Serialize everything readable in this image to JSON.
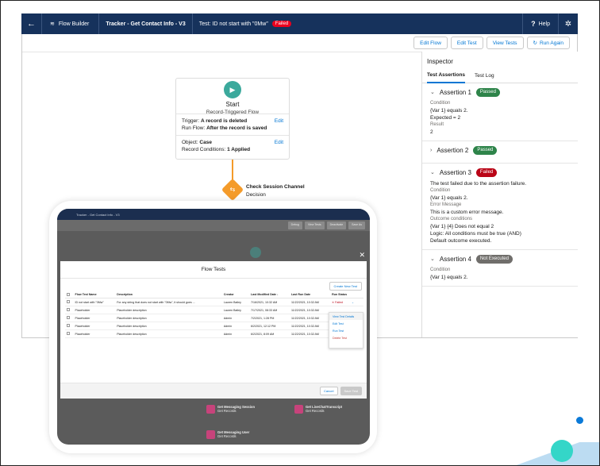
{
  "topbar": {
    "app_name": "Flow Builder",
    "flow_title": "Tracker - Get Contact Info - V3",
    "test_title": "Test: ID not start with \"0Mw\"",
    "test_status": "Failed",
    "help": "Help"
  },
  "toolbar": {
    "edit_flow": "Edit Flow",
    "edit_test": "Edit Test",
    "view_tests": "View Tests",
    "run_again": "Run Again"
  },
  "start": {
    "title": "Start",
    "subtitle": "Record-Triggered Flow",
    "trigger_label": "Trigger:",
    "trigger_value": "A record is deleted",
    "run_label": "Run Flow:",
    "run_value": "After the record is saved",
    "object_label": "Object:",
    "object_value": "Case",
    "conditions_label": "Record Conditions:",
    "conditions_value": "1 Applied",
    "edit": "Edit"
  },
  "decision": {
    "name": "Check Session Channel",
    "type": "Decision"
  },
  "inspector": {
    "title": "Inspector",
    "tabs": [
      "Test Assertions",
      "Test Log"
    ],
    "assertions": [
      {
        "name": "Assertion 1",
        "status": "Passed",
        "lines": [
          [
            "Condition",
            "lbl"
          ],
          [
            "{Var 1} equals 2.",
            ""
          ],
          [
            "Expected = 2",
            ""
          ],
          [
            "Result",
            "lbl"
          ],
          [
            "2",
            ""
          ]
        ]
      },
      {
        "name": "Assertion 2",
        "status": "Passed",
        "lines": []
      },
      {
        "name": "Assertion 3",
        "status": "Failed",
        "lines": [
          [
            "The test failed due to the assertion failure.",
            ""
          ],
          [
            "Condition",
            "lbl"
          ],
          [
            "{Var 1} equals 2.",
            ""
          ],
          [
            "Error Message",
            "lbl"
          ],
          [
            "This is a custom error message.",
            ""
          ],
          [
            "Outcome conditions",
            "lbl"
          ],
          [
            "{Var 1} {4} Does not equal 2",
            ""
          ],
          [
            "Logic: All conditions must be true (AND)",
            ""
          ],
          [
            "Default outcome executed.",
            ""
          ]
        ]
      },
      {
        "name": "Assertion 4",
        "status": "Not Executed",
        "lines": [
          [
            "Condition",
            "lbl"
          ],
          [
            "{Var 1} equals 2.",
            ""
          ]
        ]
      }
    ]
  },
  "overlay": {
    "header_title": "Tracker - Get Contact Info - V3",
    "bar_buttons": [
      "Debug",
      "View Tests",
      "Deactivate",
      "Save As"
    ],
    "modal_title": "Flow Tests",
    "create_button": "Create New Test",
    "columns": [
      "Flow Test Name",
      "Description",
      "Creator",
      "Last Modified Date ↓",
      "Last Run Date",
      "Run Status"
    ],
    "rows": [
      [
        "ID not start with \"0Mw\"",
        "For any string that does not start with \"0Mw\", it should goes ...",
        "Lauren Bailey",
        "7/16/2021, 10:32 AM",
        "11/22/2021, 10:32 AM",
        "Failed"
      ],
      [
        "Placeholder",
        "Placeholder description",
        "Lauren Bailey",
        "7/17/2021, 08:33 AM",
        "11/22/2021, 10:32 AM",
        ""
      ],
      [
        "Placeholder",
        "Placeholder description",
        "Admin",
        "7/2/2021, 1:28 PM",
        "11/22/2021, 10:32 AM",
        ""
      ],
      [
        "Placeholder",
        "Placeholder description",
        "Admin",
        "6/2/2021, 12:12 PM",
        "11/22/2021, 10:32 AM",
        ""
      ],
      [
        "Placeholder",
        "Placeholder description",
        "Admin",
        "6/2/2021, 8:09 AM",
        "11/22/2021, 10:32 AM",
        ""
      ]
    ],
    "menu": [
      "View Test Details",
      "Edit Test",
      "Run Test",
      "Delete Test"
    ],
    "cancel": "Cancel",
    "save": "Save Test",
    "nodes": [
      {
        "name": "Get Messaging Session",
        "type": "Get Records"
      },
      {
        "name": "Get LiveChatTranscript",
        "type": "Get Records"
      },
      {
        "name": "Get Messaging User",
        "type": "Get Records"
      }
    ]
  },
  "colors": {
    "nav": "#16325c",
    "brand": "#0176d3",
    "passed": "#2e844a",
    "failed": "#ba0517",
    "decision": "#f49b2a",
    "start": "#3ba99c"
  }
}
